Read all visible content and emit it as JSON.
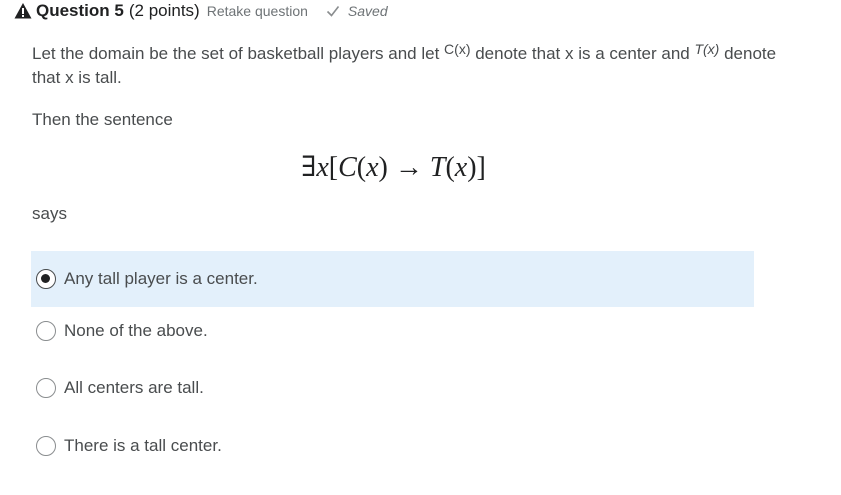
{
  "header": {
    "question_title": "Question 5",
    "points": "(2 points)",
    "retake_label": "Retake question",
    "saved_label": "Saved",
    "warning_icon": "warning-triangle-icon",
    "check_icon": "checkmark-icon"
  },
  "prompt": {
    "text_1": "Let the domain be the set of basketball players and let ",
    "math_c": "C(x)",
    "text_2": " denote that x is a center and ",
    "math_t": "T(x)",
    "text_3": " denote that x is tall.",
    "then": "Then the sentence",
    "says": "says"
  },
  "formula": {
    "exists": "∃",
    "var": "x",
    "open_bracket": "[",
    "c_pred": "C",
    "open_paren1": "(",
    "x1": "x",
    "close_paren1": ")",
    "arrow": " → ",
    "t_pred": "T",
    "open_paren2": "(",
    "x2": "x",
    "close_paren2": ")",
    "close_bracket": "]"
  },
  "options": [
    {
      "label": "Any tall player is a center.",
      "selected": true
    },
    {
      "label": "None of the above.",
      "selected": false
    },
    {
      "label": "All centers are tall.",
      "selected": false
    },
    {
      "label": "There is a tall center.",
      "selected": false
    }
  ],
  "colors": {
    "selected_background": "#e3f0fb",
    "text": "#494c4e",
    "title": "#202122",
    "muted": "#6e7376"
  }
}
